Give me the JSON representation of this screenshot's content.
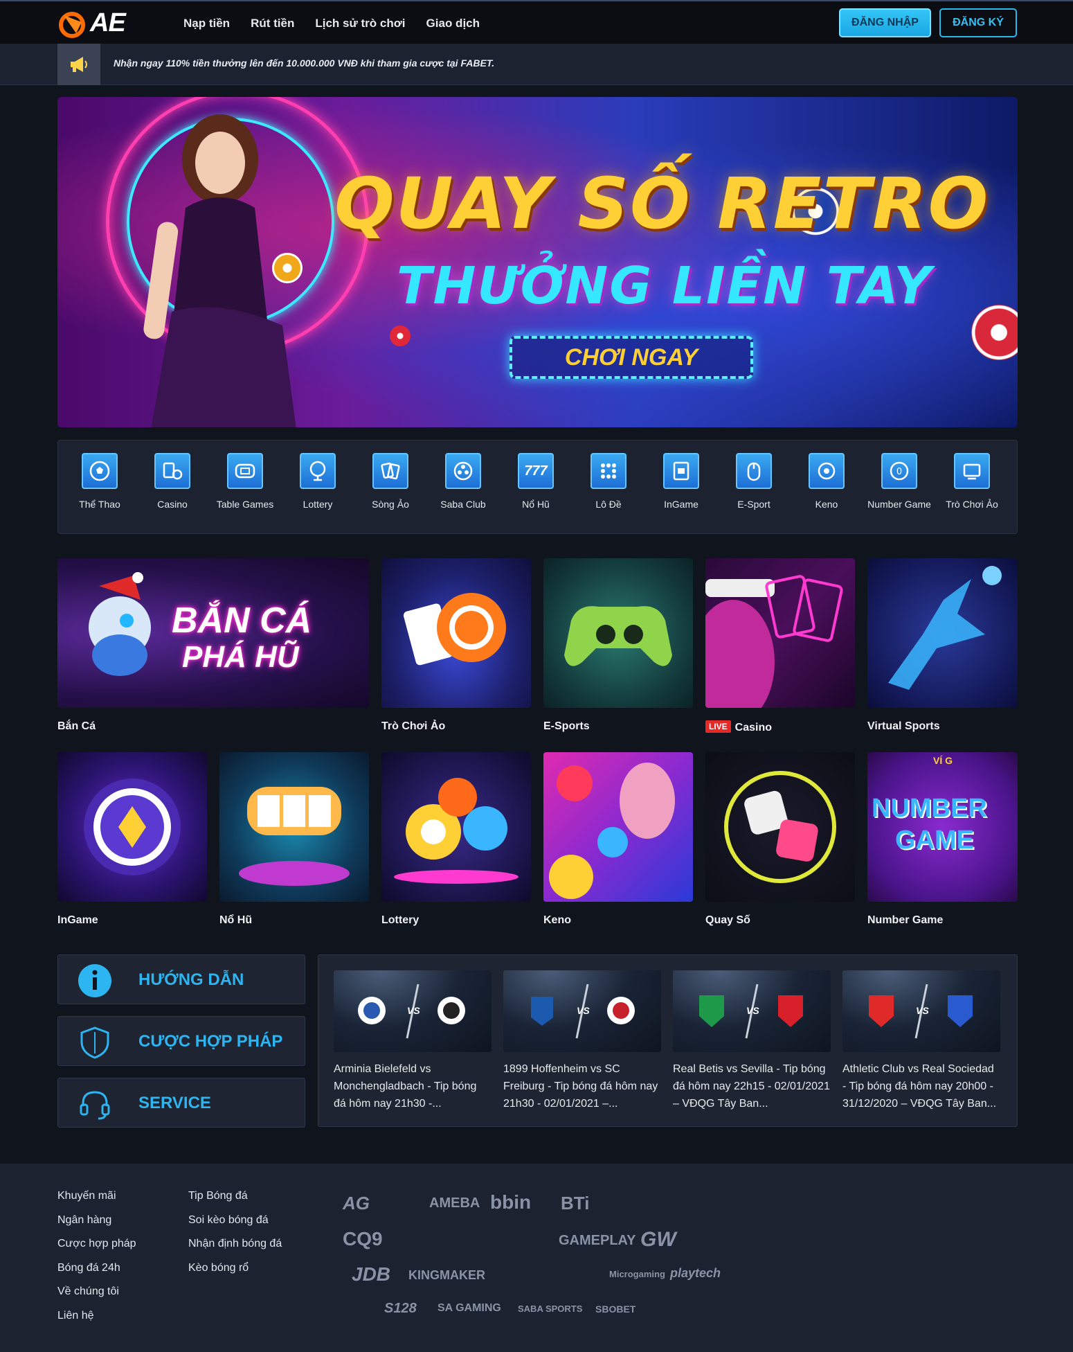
{
  "header": {
    "logo_text": "AE",
    "nav": [
      "Nạp tiền",
      "Rút tiền",
      "Lịch sử trò chơi",
      "Giao dịch"
    ],
    "login": "ĐĂNG NHẬP",
    "register": "ĐĂNG KÝ"
  },
  "marquee": {
    "text": "Nhận ngay 110% tiền thưởng lên đến 10.000.000 VNĐ khi tham gia cược tại FABET."
  },
  "hero": {
    "title1": "QUAY SỐ RETRO",
    "title2": "THƯỞNG LIỀN TAY",
    "cta": "CHƠI NGAY"
  },
  "categories": [
    "Thể Thao",
    "Casino",
    "Table Games",
    "Lottery",
    "Sòng Ảo",
    "Saba Club",
    "Nổ Hũ",
    "Lô Đề",
    "InGame",
    "E-Sport",
    "Keno",
    "Number Game",
    "Trò Chơi Ảo"
  ],
  "games_row1": {
    "banca_label": "Bắn Cá",
    "banca_art1": "BẮN CÁ",
    "banca_art2": "PHÁ HŨ",
    "trochoiao": "Trò Chơi Ảo",
    "esports": "E-Sports",
    "live_badge": "LIVE",
    "casino": "Casino",
    "virtual": "Virtual Sports"
  },
  "games_row2": {
    "ingame": "InGame",
    "nohu": "Nổ Hũ",
    "lottery": "Lottery",
    "keno": "Keno",
    "quayso": "Quay Số",
    "numbergame": "Number Game",
    "ng_art1": "NUMBER",
    "ng_art2": "GAME",
    "ng_art_top": "VÍ G"
  },
  "info": {
    "guide": "HƯỚNG DẪN",
    "legal": "CƯỢC HỢP PHÁP",
    "service": "SERVICE"
  },
  "news": [
    "Arminia Bielefeld vs Monchengladbach - Tip bóng đá hôm nay 21h30 -...",
    "1899 Hoffenheim vs SC Freiburg - Tip bóng đá hôm nay 21h30 - 02/01/2021 –...",
    "Real Betis vs Sevilla - Tip bóng đá hôm nay 22h15 - 02/01/2021 – VĐQG Tây Ban...",
    "Athletic Club vs Real Sociedad - Tip bóng đá hôm nay 20h00 - 31/12/2020 – VĐQG Tây Ban..."
  ],
  "vs_text": "VS",
  "footer": {
    "col1": [
      "Khuyến mãi",
      "Ngân hàng",
      "Cược hợp pháp",
      "Bóng đá 24h",
      "Về chúng tôi",
      "Liên hệ"
    ],
    "col2": [
      "Tip Bóng đá",
      "Soi kèo bóng đá",
      "Nhận định bóng đá",
      "Kèo bóng rổ"
    ],
    "partners": [
      "AG",
      "AMEBA",
      "bbin",
      "BTi",
      "CQ9",
      "GAMEPLAY",
      "GW",
      "JDB",
      "KINGMAKER",
      "Microgaming",
      "playtech",
      "S128",
      "SA GAMING",
      "SABA SPORTS",
      "SBOBET"
    ]
  },
  "colors": {
    "accent": "#2cb5f0",
    "bg": "#10141d",
    "panel": "#1c2230"
  }
}
